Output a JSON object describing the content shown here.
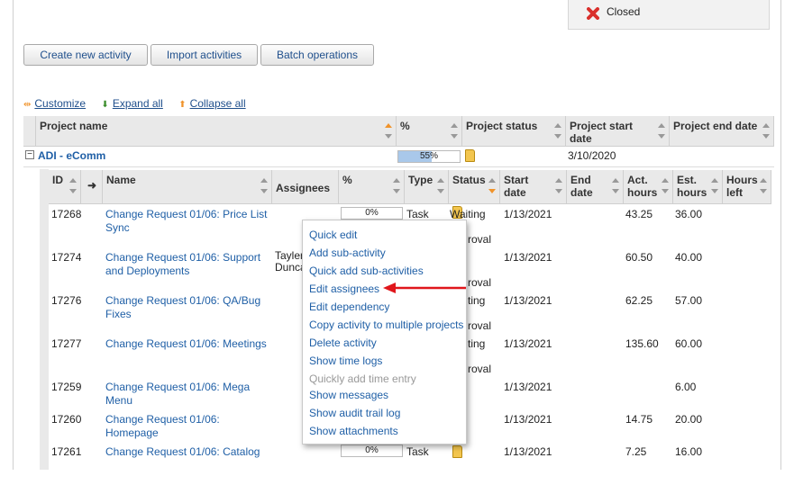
{
  "legend": {
    "closed_label": "Closed"
  },
  "buttons": {
    "create": "Create new activity",
    "import": "Import activities",
    "batch": "Batch operations"
  },
  "links": {
    "customize": "Customize",
    "expand": "Expand all",
    "collapse": "Collapse all"
  },
  "project_table": {
    "headers": {
      "name": "Project name",
      "percent": "%",
      "status": "Project status",
      "start": "Project start date",
      "end": "Project end date"
    },
    "project": {
      "name": "ADI - eComm",
      "percent_label": "55%",
      "percent": 0.55,
      "start": "3/10/2020",
      "end": ""
    }
  },
  "activity_table": {
    "headers": {
      "id": "ID",
      "name": "Name",
      "assignees": "Assignees",
      "percent": "%",
      "type": "Type",
      "status": "Status",
      "start": "Start date",
      "end": "End date",
      "act": "Act. hours",
      "est": "Est. hours",
      "left": "Hours left"
    },
    "rows": [
      {
        "id": "17268",
        "name": "Change Request 01/06: Price List Sync",
        "assignees": "",
        "pct": "0%",
        "type": "Task",
        "status": "Waiting",
        "status2": "roval",
        "start": "1/13/2021",
        "end": "",
        "act": "43.25",
        "est": "36.00",
        "left": ""
      },
      {
        "id": "17274",
        "name": "Change Request 01/06: Support and Deployments",
        "assignees": "Tayler",
        "assignees2": "Dunca",
        "pct": "",
        "type": "",
        "status": "",
        "status2": "roval",
        "start": "1/13/2021",
        "end": "",
        "act": "60.50",
        "est": "40.00",
        "left": ""
      },
      {
        "id": "17276",
        "name": "Change Request 01/06: QA/Bug Fixes",
        "assignees": "",
        "pct": "",
        "type": "",
        "status": "ting",
        "status2": "roval",
        "start": "1/13/2021",
        "end": "",
        "act": "62.25",
        "est": "57.00",
        "left": ""
      },
      {
        "id": "17277",
        "name": "Change Request 01/06: Meetings",
        "assignees": "",
        "pct": "",
        "type": "",
        "status": "ting",
        "status2": "roval",
        "start": "1/13/2021",
        "end": "",
        "act": "135.60",
        "est": "60.00",
        "left": ""
      },
      {
        "id": "17259",
        "name": "Change Request 01/06: Mega Menu",
        "assignees": "",
        "pct": "",
        "type": "",
        "status": "",
        "status2": "",
        "start": "1/13/2021",
        "end": "",
        "act": "",
        "est": "",
        "left": "6.00"
      },
      {
        "id": "17260",
        "name": "Change Request 01/06: Homepage",
        "assignees": "",
        "pct": "",
        "type": "",
        "status": "",
        "status2": "",
        "start": "1/13/2021",
        "end": "",
        "act": "14.75",
        "est": "20.00",
        "left": ""
      },
      {
        "id": "17261",
        "name": "Change Request 01/06: Catalog",
        "assignees": "",
        "pct": "0%",
        "type": "Task",
        "status": "",
        "status2": "",
        "start": "1/13/2021",
        "end": "",
        "act": "7.25",
        "est": "16.00",
        "left": ""
      }
    ]
  },
  "context_menu": {
    "items": [
      {
        "label": "Quick edit",
        "disabled": false
      },
      {
        "label": "Add sub-activity",
        "disabled": false
      },
      {
        "label": "Quick add sub-activities",
        "disabled": false
      },
      {
        "label": "Edit assignees",
        "disabled": false
      },
      {
        "label": "Edit dependency",
        "disabled": false
      },
      {
        "label": "Copy activity to multiple projects",
        "disabled": false
      },
      {
        "label": "Delete activity",
        "disabled": false
      },
      {
        "label": "Show time logs",
        "disabled": false
      },
      {
        "label": "Quickly add time entry",
        "disabled": true
      },
      {
        "label": "Show messages",
        "disabled": false
      },
      {
        "label": "Show audit trail log",
        "disabled": false
      },
      {
        "label": "Show attachments",
        "disabled": false
      }
    ]
  },
  "colors": {
    "accent_link": "#1f5fa6",
    "arrow": "#e0161b",
    "closed_icon": "#d9302c",
    "progress_fill": "#a9c8ea"
  }
}
